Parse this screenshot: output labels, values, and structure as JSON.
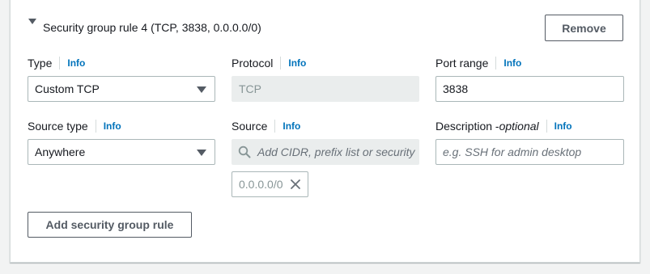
{
  "rule": {
    "title": "Security group rule 4 (TCP, 3838, 0.0.0.0/0)",
    "remove_label": "Remove"
  },
  "fields": {
    "type": {
      "label": "Type",
      "info": "Info",
      "value": "Custom TCP"
    },
    "protocol": {
      "label": "Protocol",
      "info": "Info",
      "value": "TCP"
    },
    "port_range": {
      "label": "Port range",
      "info": "Info",
      "value": "3838"
    },
    "source_type": {
      "label": "Source type",
      "info": "Info",
      "value": "Anywhere"
    },
    "source": {
      "label": "Source",
      "info": "Info",
      "placeholder": "Add CIDR, prefix list or security",
      "token": "0.0.0.0/0"
    },
    "description": {
      "label": "Description - ",
      "label_optional": "optional",
      "info": "Info",
      "placeholder": "e.g. SSH for admin desktop"
    }
  },
  "add_rule_label": "Add security group rule",
  "colors": {
    "link": "#0073bb",
    "border": "#aab7b8",
    "disabled_bg": "#eaeded",
    "page_bg": "#f2f3f3"
  }
}
